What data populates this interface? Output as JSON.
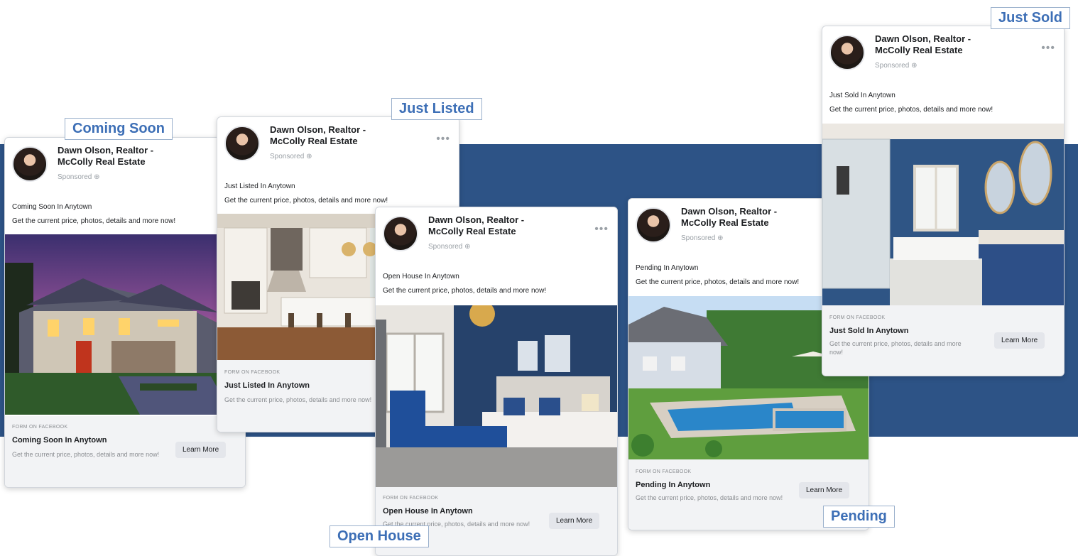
{
  "colors": {
    "band": "#2d5386",
    "label_text": "#3d6fb6",
    "card_bg": "#ffffff",
    "footer_bg": "#f2f3f5"
  },
  "shared": {
    "advertiser": "Dawn Olson, Realtor - McColly Real Estate",
    "sponsored": "Sponsored",
    "body_line2": "Get the current price, photos, details and more now!",
    "form_label": "FORM ON FACEBOOK",
    "link_desc": "Get the current price, photos, details and more now!",
    "cta": "Learn More",
    "more_icon": "more-options-icon"
  },
  "cards": {
    "coming_soon": {
      "tag": "Coming Soon",
      "body_line1": "Coming Soon In Anytown",
      "link_title": "Coming Soon In Anytown"
    },
    "just_listed": {
      "tag": "Just Listed",
      "body_line1": "Just Listed In Anytown",
      "link_title": "Just Listed In Anytown"
    },
    "open_house": {
      "tag": "Open House",
      "body_line1": "Open House In Anytown",
      "link_title": "Open House In Anytown"
    },
    "pending": {
      "tag": "Pending",
      "body_line1": "Pending In Anytown",
      "link_title": "Pending In Anytown"
    },
    "just_sold": {
      "tag": "Just Sold",
      "body_line1": "Just Sold In Anytown",
      "link_title": "Just Sold In Anytown"
    }
  }
}
